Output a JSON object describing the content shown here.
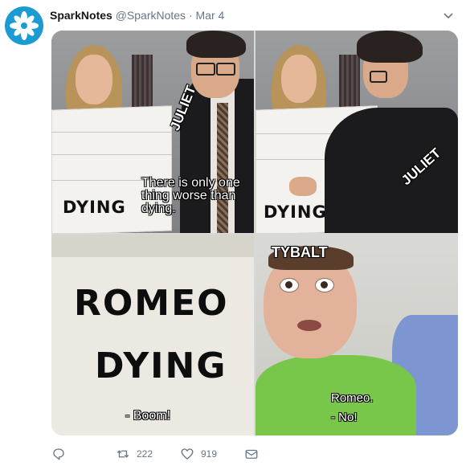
{
  "tweet": {
    "display_name": "SparkNotes",
    "handle": "@SparkNotes",
    "separator": "·",
    "date": "Mar 4"
  },
  "meme": {
    "panel1": {
      "board_label": "DYING",
      "tag": "JULIET",
      "caption": "There is only one thing worse than dying."
    },
    "panel2": {
      "board_label": "DYING",
      "tag": "JULIET"
    },
    "panel3": {
      "line1": "ROMEO",
      "line2": "DYING",
      "caption": "- Boom!"
    },
    "panel4": {
      "tag": "TYBALT",
      "caption_line1": "Romeo.",
      "caption_line2": "- No!"
    }
  },
  "actions": {
    "reply_icon": "reply-icon",
    "retweet_icon": "retweet-icon",
    "retweet_count": "222",
    "like_icon": "heart-icon",
    "like_count": "919",
    "dm_icon": "envelope-icon"
  },
  "colors": {
    "avatar_bg": "#1b9bd1",
    "meta_text": "#657786"
  }
}
